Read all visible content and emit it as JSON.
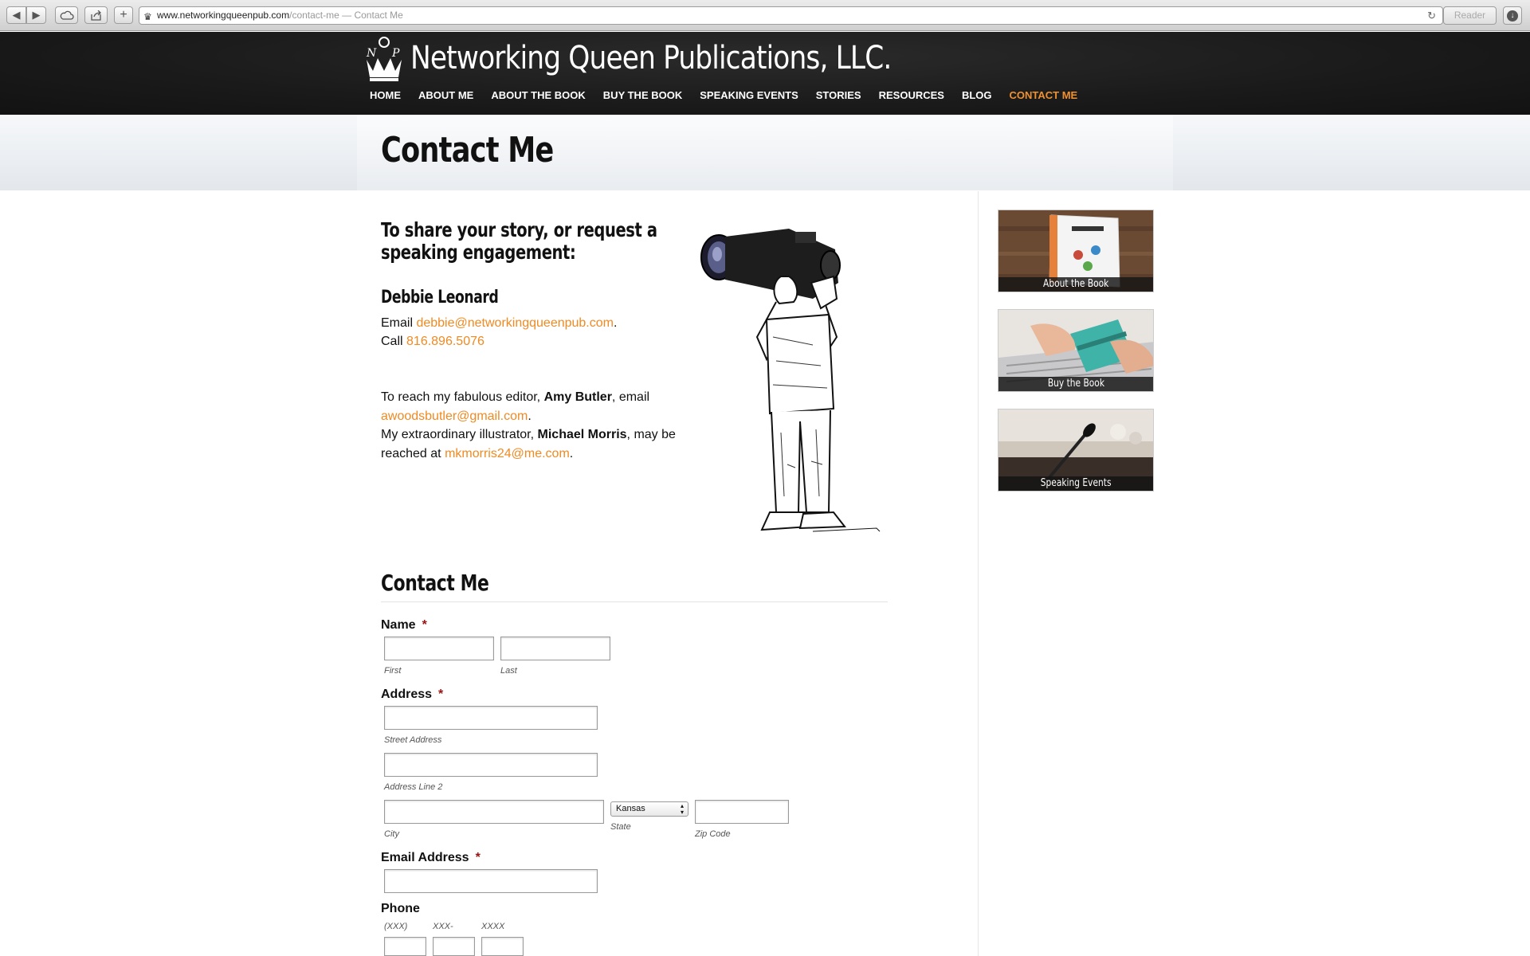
{
  "browser": {
    "url_host": "www.networkingqueenpub.com",
    "url_rest": "/contact-me — Contact Me",
    "reader_label": "Reader"
  },
  "site": {
    "name": "Networking Queen Publications, LLC.",
    "nav": [
      {
        "label": "HOME"
      },
      {
        "label": "ABOUT ME"
      },
      {
        "label": "ABOUT THE BOOK"
      },
      {
        "label": "BUY THE BOOK"
      },
      {
        "label": "SPEAKING EVENTS"
      },
      {
        "label": "STORIES"
      },
      {
        "label": "RESOURCES"
      },
      {
        "label": "BLOG"
      },
      {
        "label": "CONTACT ME",
        "active": true
      }
    ],
    "accent_color": "#f0912e"
  },
  "page": {
    "title": "Contact Me",
    "intro_heading_line1": "To share your story, or request a",
    "intro_heading_line2": "speaking engagement:",
    "contact_name": "Debbie Leonard",
    "email_prefix": "Email ",
    "email": "debbie@networkingqueenpub.com",
    "email_suffix": ".",
    "call_prefix": "Call ",
    "phone": "816.896.5076",
    "editor_line1_a": "To reach my fabulous editor, ",
    "editor_name": "Amy Butler",
    "editor_line1_b": ", email",
    "editor_email": "awoodsbutler@gmail.com",
    "editor_email_suffix": ".",
    "illustrator_line_a": "My extraordinary illustrator, ",
    "illustrator_name": "Michael Morris",
    "illustrator_line_b": ", may be",
    "illustrator_reach_prefix": "reached at ",
    "illustrator_email": "mkmorris24@me.com",
    "illustrator_email_suffix": "."
  },
  "form": {
    "heading": "Contact Me",
    "required_mark": "*",
    "name_label": "Name",
    "first_sub": "First",
    "last_sub": "Last",
    "address_label": "Address",
    "street_sub": "Street Address",
    "line2_sub": "Address Line 2",
    "city_sub": "City",
    "state_sub": "State",
    "state_value": "Kansas",
    "zip_sub": "Zip Code",
    "email_label": "Email Address",
    "phone_label": "Phone",
    "phone_area_sub": "(XXX)",
    "phone_prefix_sub": "XXX-",
    "phone_line_sub": "XXXX"
  },
  "sidebar": {
    "widgets": [
      {
        "caption": "About the Book"
      },
      {
        "caption": "Buy the Book"
      },
      {
        "caption": "Speaking Events"
      }
    ]
  }
}
